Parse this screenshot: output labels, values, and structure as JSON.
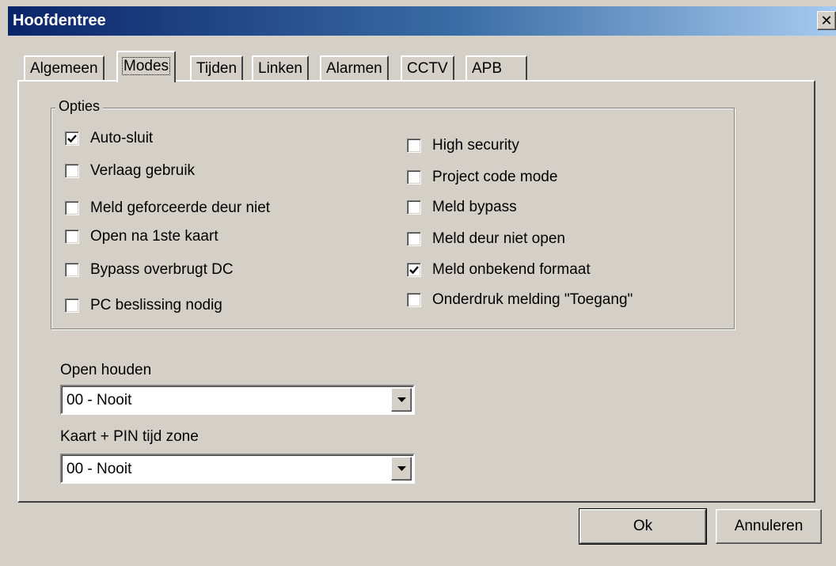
{
  "window": {
    "title": "Hoofdentree"
  },
  "tabs": [
    "Algemeen",
    "Modes",
    "Tijden",
    "Linken",
    "Alarmen",
    "CCTV",
    "APB"
  ],
  "active_tab": "Modes",
  "options": {
    "group_label": "Opties",
    "left": [
      {
        "label": "Auto-sluit",
        "checked": true
      },
      {
        "label": "Verlaag gebruik",
        "checked": false
      },
      {
        "label": "Meld geforceerde deur niet",
        "checked": false
      },
      {
        "label": "Open na 1ste kaart",
        "checked": false
      },
      {
        "label": "Bypass overbrugt DC",
        "checked": false
      },
      {
        "label": "PC beslissing nodig",
        "checked": false
      }
    ],
    "right": [
      {
        "label": "High security",
        "checked": false
      },
      {
        "label": "Project code mode",
        "checked": false
      },
      {
        "label": "Meld bypass",
        "checked": false
      },
      {
        "label": "Meld deur niet open",
        "checked": false
      },
      {
        "label": "Meld onbekend formaat",
        "checked": true
      },
      {
        "label": "Onderdruk melding \"Toegang\"",
        "checked": false
      }
    ]
  },
  "open_houden": {
    "label": "Open houden",
    "value": "00 - Nooit"
  },
  "kaart_pin": {
    "label": "Kaart + PIN tijd zone",
    "value": "00 - Nooit"
  },
  "buttons": {
    "ok": "Ok",
    "cancel": "Annuleren"
  }
}
